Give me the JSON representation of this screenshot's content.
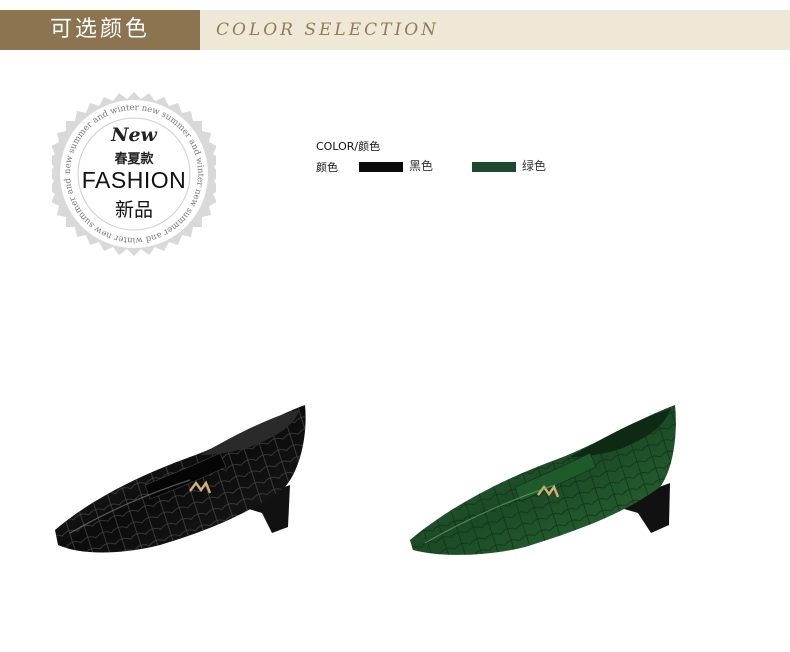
{
  "banner": {
    "title_cn": "可选颜色",
    "title_en": "COLOR SELECTION"
  },
  "badge": {
    "new": "New",
    "cn_line1": "春夏款",
    "fashion": "FASHION",
    "cn_line2": "新品",
    "ring_text": "new summer and winter new summer and winter new summer and winter new summer and winter"
  },
  "colors": {
    "title": "COLOR/颜色",
    "label": "颜色",
    "options": [
      {
        "name": "黑色",
        "hex": "#0a0a0a"
      },
      {
        "name": "绿色",
        "hex": "#1d4a2c"
      }
    ]
  },
  "products": [
    {
      "color_name": "黑色",
      "icon": "black-shoe-image"
    },
    {
      "color_name": "绿色",
      "icon": "green-shoe-image"
    }
  ]
}
